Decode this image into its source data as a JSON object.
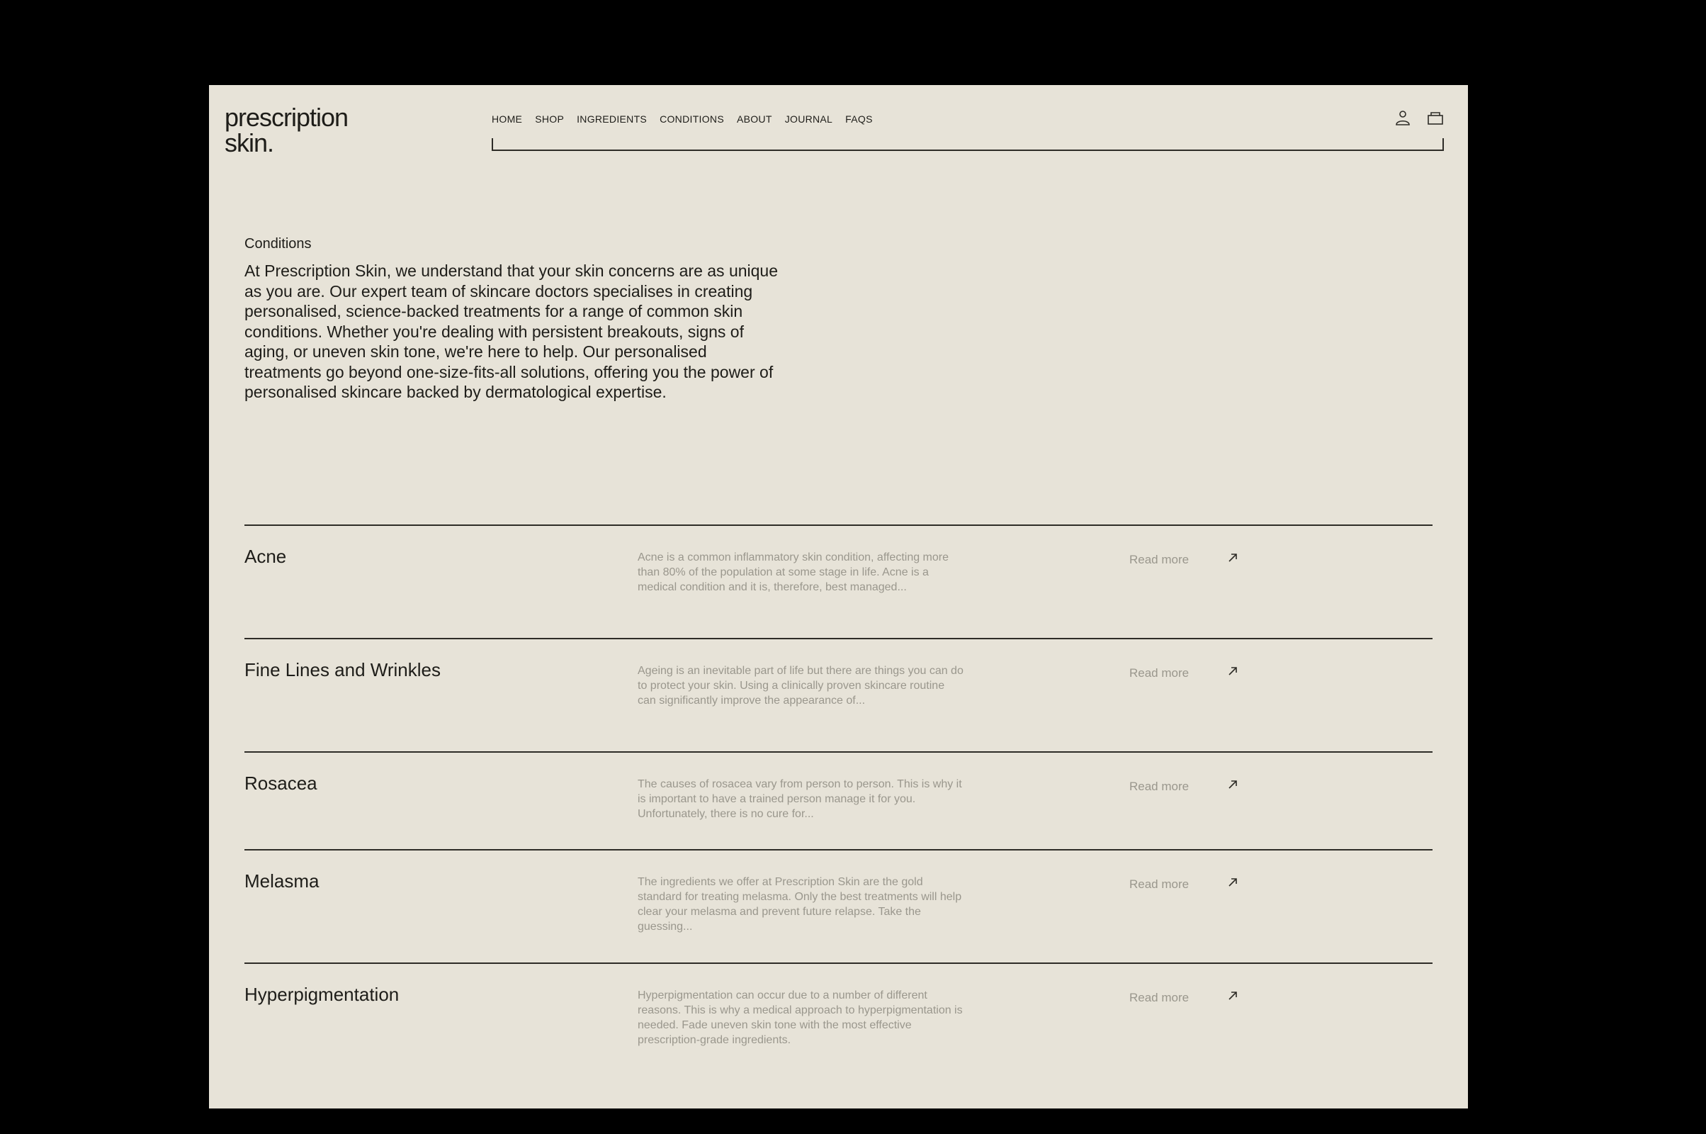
{
  "logo": {
    "line1": "prescription",
    "line2": "skin."
  },
  "nav": {
    "items": [
      {
        "label": "HOME"
      },
      {
        "label": "SHOP"
      },
      {
        "label": "INGREDIENTS"
      },
      {
        "label": "CONDITIONS"
      },
      {
        "label": "ABOUT"
      },
      {
        "label": "JOURNAL"
      },
      {
        "label": "FAQS"
      }
    ],
    "icons": [
      "account-icon",
      "bag-icon"
    ]
  },
  "intro": {
    "eyebrow": "Conditions",
    "body": "At Prescription Skin, we understand that your skin concerns are as unique as you are. Our expert team of skincare doctors specialises in creating personalised, science-backed treatments for a range of common skin conditions. Whether you're dealing with persistent breakouts, signs of aging, or uneven skin tone, we're here to help. Our personalised treatments go beyond one-size-fits-all solutions, offering you the power of personalised skincare backed by dermatological expertise."
  },
  "conditions": [
    {
      "title": "Acne",
      "description": "Acne is a common inflammatory skin condition, affecting more than 80% of the population at some stage in life. Acne is a medical condition and it is, therefore, best managed...",
      "link": "Read more"
    },
    {
      "title": "Fine Lines and Wrinkles",
      "description": "Ageing is an inevitable part of life but there are things you can do to protect your skin. Using a clinically proven skincare routine can significantly improve the appearance of...",
      "link": "Read more"
    },
    {
      "title": "Rosacea",
      "description": "The causes of rosacea vary from person to person. This is why it is important to have a trained person manage it for you. Unfortunately, there is no cure for...",
      "link": "Read more"
    },
    {
      "title": "Melasma",
      "description": "The ingredients we offer at Prescription Skin are the gold standard for treating melasma. Only the best treatments will help clear your melasma and prevent future relapse. Take the guessing...",
      "link": "Read more"
    },
    {
      "title": "Hyperpigmentation",
      "description": "Hyperpigmentation can occur due to a number of different reasons. This is why a medical approach to hyperpigmentation is needed. Fade uneven skin tone with the most effective prescription-grade ingredients.",
      "link": "Read more"
    }
  ],
  "colors": {
    "background": "#e7e3d8",
    "text": "#1e1d19",
    "muted": "#9a978d",
    "frame": "#000000"
  }
}
